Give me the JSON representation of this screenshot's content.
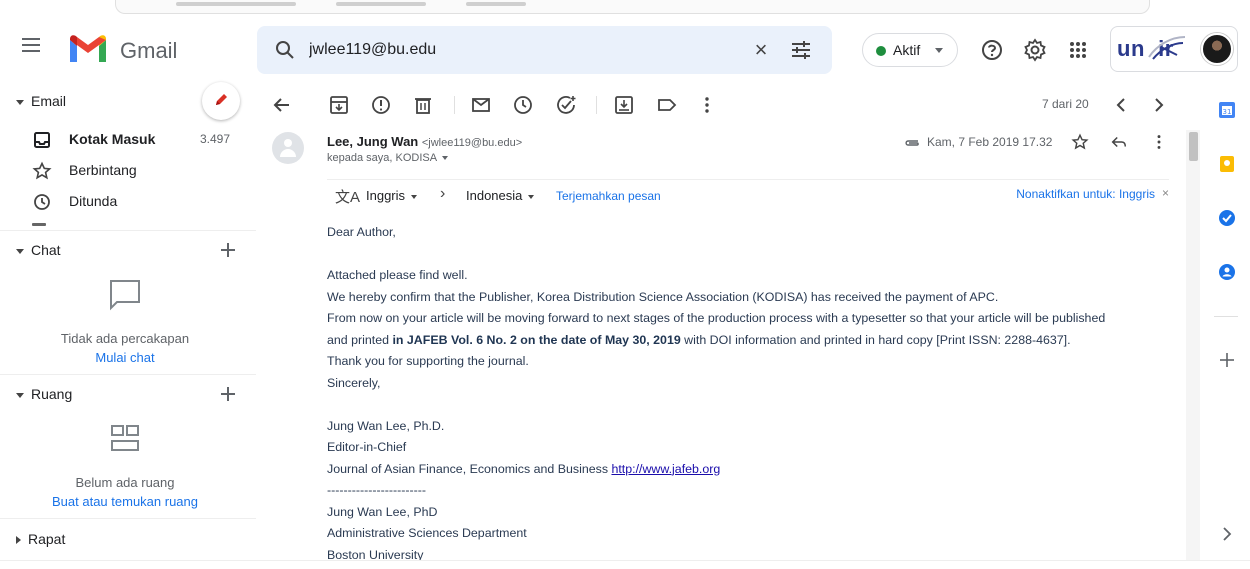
{
  "app": {
    "name": "Gmail"
  },
  "search": {
    "value": "jwlee119@bu.edu"
  },
  "status": {
    "label": "Aktif",
    "color": "#1e8e3e"
  },
  "org": {
    "logo_text": "un  ir"
  },
  "sidebar": {
    "email_section": "Email",
    "items": [
      {
        "label": "Kotak Masuk",
        "count": "3.497",
        "icon": "inbox-icon"
      },
      {
        "label": "Berbintang",
        "count": "",
        "icon": "star-icon"
      },
      {
        "label": "Ditunda",
        "count": "",
        "icon": "clock-icon"
      }
    ],
    "chat": {
      "title": "Chat",
      "empty_text": "Tidak ada percakapan",
      "link": "Mulai chat"
    },
    "rooms": {
      "title": "Ruang",
      "empty_text": "Belum ada ruang",
      "link": "Buat atau temukan ruang"
    },
    "meet": {
      "title": "Rapat"
    }
  },
  "toolbar": {
    "pager": "7 dari 20"
  },
  "message": {
    "sender_name": "Lee, Jung Wan",
    "sender_email": "<jwlee119@bu.edu>",
    "recipients": "kepada saya, KODISA",
    "date": "Kam, 7 Feb 2019 17.32",
    "translate": {
      "source": "Inggris",
      "target": "Indonesia",
      "action": "Terjemahkan pesan",
      "disable": "Nonaktifkan untuk: Inggris"
    },
    "body": {
      "greeting": "Dear Author,",
      "l1": "Attached please find well.",
      "l2": "We hereby confirm that the Publisher, Korea Distribution Science Association (KODISA) has received the payment of APC.",
      "l3": "From now on your article will be moving forward to next stages of the production process with a typesetter so that your article will be published",
      "l4a": "and printed ",
      "l4b": "in JAFEB Vol. 6 No. 2 on the date of May 30, 2019",
      "l4c": " with DOI information and printed in hard copy [Print ISSN: 2288-4637].",
      "l5": "Thank you for supporting the journal.",
      "l6": "Sincerely,",
      "sig_name": "Jung Wan Lee, Ph.D.",
      "sig_title": "Editor-in-Chief",
      "sig_journal": "Journal of Asian Finance, Economics and Business ",
      "sig_link": "http://www.jafeb.org",
      "sig_rule": "------------------------",
      "sig2_name": "Jung Wan Lee, PhD",
      "sig2_dept": "Administrative Sciences Department",
      "sig2_univ": "Boston University"
    }
  },
  "colors": {
    "accent": "#1a73e8",
    "gmail_red": "#ea4335"
  }
}
